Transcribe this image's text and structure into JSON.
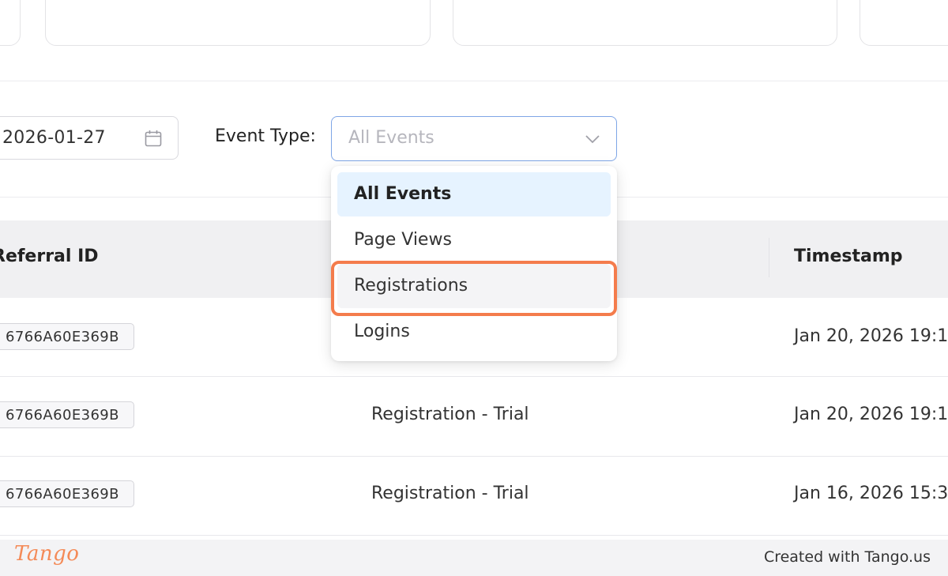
{
  "filters": {
    "date_value": "2026-01-27",
    "event_type_label": "Event Type:",
    "event_type_placeholder": "All Events"
  },
  "dropdown": {
    "options": [
      {
        "label": "All Events",
        "selected": true
      },
      {
        "label": "Page Views",
        "selected": false
      },
      {
        "label": "Registrations",
        "selected": false,
        "highlighted": true
      },
      {
        "label": "Logins",
        "selected": false
      }
    ]
  },
  "table": {
    "headers": {
      "referral_id": "Referral ID",
      "timestamp": "Timestamp"
    },
    "rows": [
      {
        "referral_id": "6766A60E369B",
        "event": "",
        "timestamp": "Jan 20, 2026 19:1"
      },
      {
        "referral_id": "6766A60E369B",
        "event": "Registration - Trial",
        "timestamp": "Jan 20, 2026 19:1"
      },
      {
        "referral_id": "6766A60E369B",
        "event": "Registration - Trial",
        "timestamp": "Jan 16, 2026 15:3"
      }
    ]
  },
  "footer": {
    "logo": "Tango",
    "credit": "Created with Tango.us"
  },
  "colors": {
    "highlight": "#f47c4c",
    "selected_option_bg": "#e6f3ff",
    "select_border": "#7fa6e6",
    "table_header_bg": "#f0f0f2"
  }
}
